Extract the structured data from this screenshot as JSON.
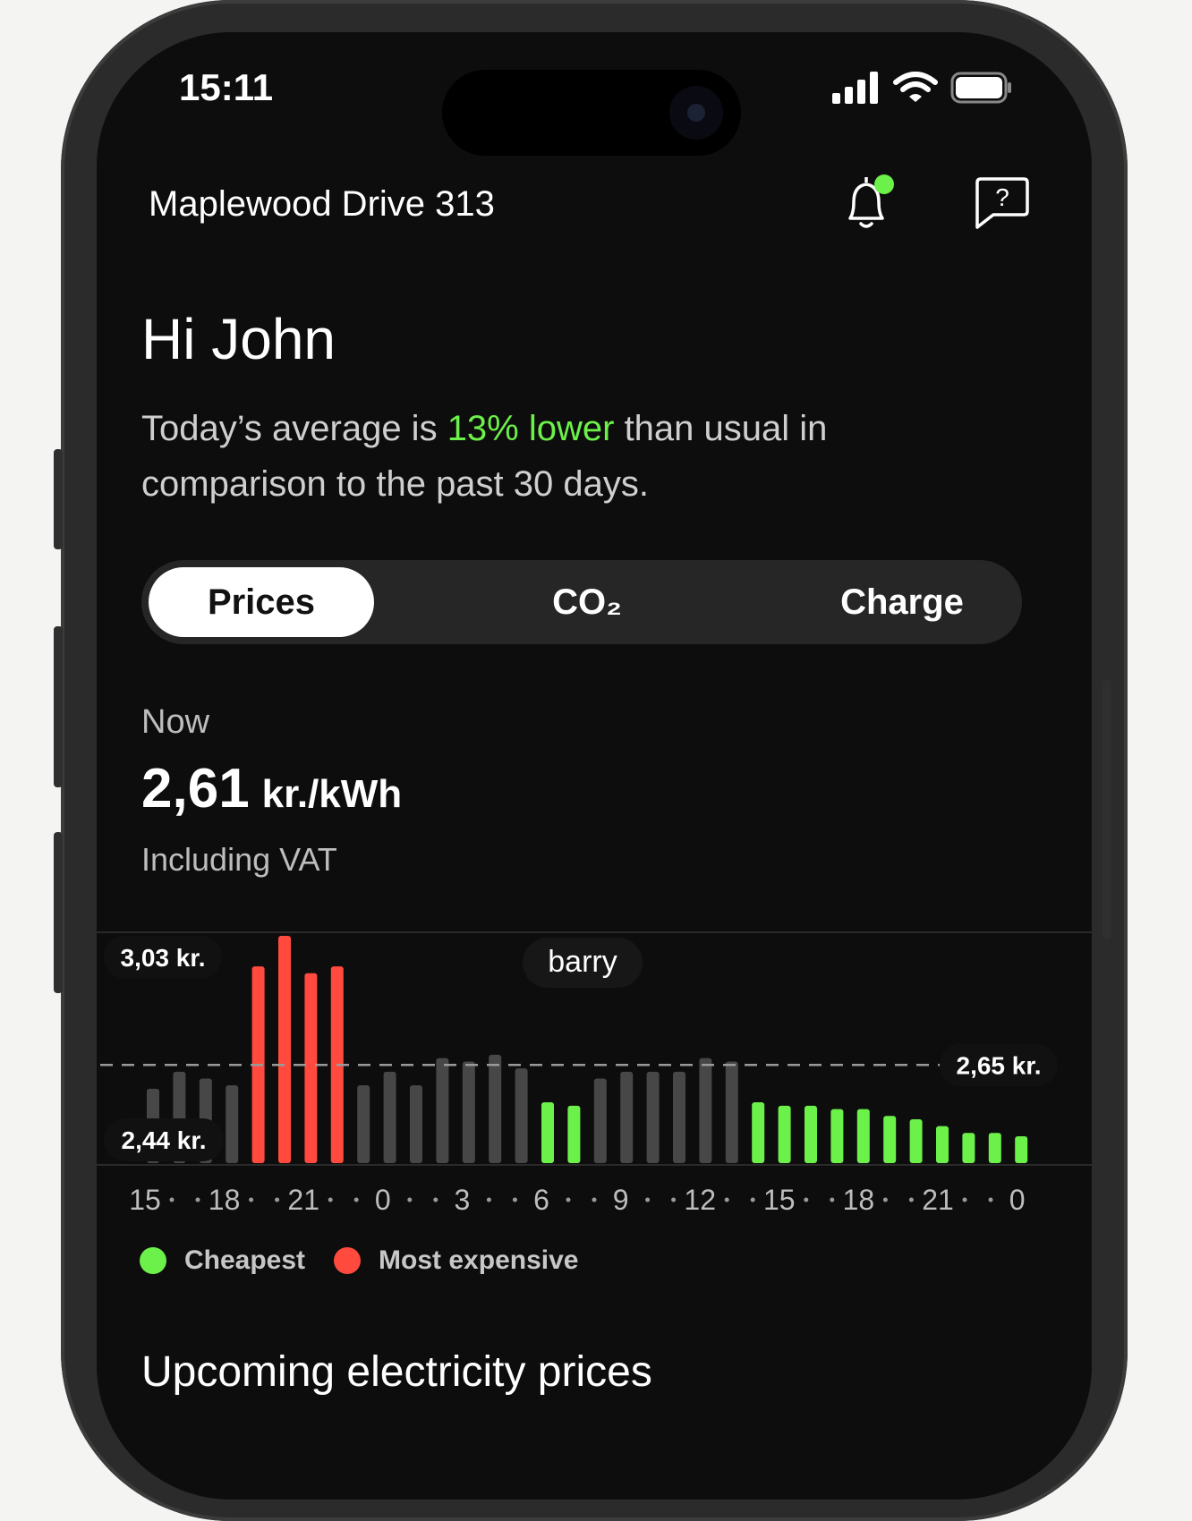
{
  "status_bar": {
    "time": "15:11"
  },
  "header": {
    "address": "Maplewood Drive 313"
  },
  "greeting": "Hi John",
  "summary": {
    "prefix": "Today’s average is ",
    "highlight": "13% lower",
    "suffix": " than usual in comparison to the past 30 days."
  },
  "tabs": [
    {
      "label": "Prices",
      "active": true
    },
    {
      "label": "CO₂",
      "active": false
    },
    {
      "label": "Charge",
      "active": false
    }
  ],
  "now": {
    "label": "Now",
    "value": "2,61",
    "unit": "kr./kWh",
    "note": "Including VAT"
  },
  "colors": {
    "cheap": "#6cf04a",
    "expensive": "#ff4a3d",
    "normal": "#474747",
    "accent": "#6cf04a"
  },
  "chart_data": {
    "type": "bar",
    "max_label": "3,03 kr.",
    "min_label": "2,44 kr.",
    "avg_label": "2,65 kr.",
    "tooltip": "barry",
    "average": 2.65,
    "ylim": [
      2.44,
      3.03
    ],
    "x_ticks": [
      "15",
      "18",
      "21",
      "0",
      "3",
      "6",
      "9",
      "12",
      "15",
      "18",
      "21",
      "0"
    ],
    "values": [
      2.58,
      2.63,
      2.61,
      2.59,
      2.94,
      3.03,
      2.92,
      2.94,
      2.59,
      2.63,
      2.59,
      2.67,
      2.66,
      2.68,
      2.64,
      2.54,
      2.53,
      2.61,
      2.63,
      2.63,
      2.63,
      2.67,
      2.66,
      2.54,
      2.53,
      2.53,
      2.52,
      2.52,
      2.5,
      2.49,
      2.47,
      2.45,
      2.45,
      2.44
    ],
    "categories": [
      "normal",
      "normal",
      "normal",
      "normal",
      "expensive",
      "expensive",
      "expensive",
      "expensive",
      "normal",
      "normal",
      "normal",
      "normal",
      "normal",
      "normal",
      "normal",
      "cheap",
      "cheap",
      "normal",
      "normal",
      "normal",
      "normal",
      "normal",
      "normal",
      "cheap",
      "cheap",
      "cheap",
      "cheap",
      "cheap",
      "cheap",
      "cheap",
      "cheap",
      "cheap",
      "cheap",
      "cheap"
    ]
  },
  "legend": [
    {
      "label": "Cheapest",
      "color": "#6cf04a"
    },
    {
      "label": "Most expensive",
      "color": "#ff4a3d"
    }
  ],
  "upcoming_title": "Upcoming electricity prices"
}
